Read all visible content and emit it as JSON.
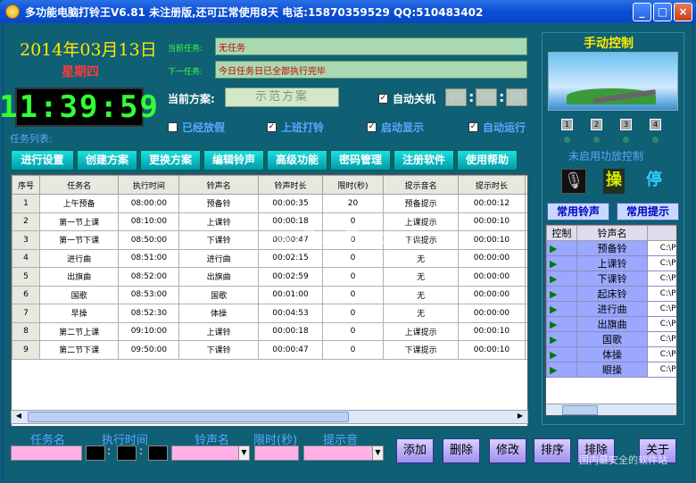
{
  "window": {
    "title": "多功能电脑打铃王V6.81 未注册版,还可正常使用8天 电话:15870359529 QQ:510483402"
  },
  "datetime": {
    "date": "2014年03月13日",
    "weekday": "星期四",
    "time": "11:39:59"
  },
  "tasks": {
    "current_label": "当前任务:",
    "current_value": "无任务",
    "next_label": "下一任务:",
    "next_value": "今日任务日已全部执行完毕"
  },
  "scheme": {
    "label": "当前方案:",
    "value": "示范方案"
  },
  "autoshutdown": {
    "label": "自动关机",
    "h": "20",
    "m": "00",
    "s": "00"
  },
  "checks": {
    "holiday": "已经放假",
    "work_bell": "上班打铃",
    "show_on_start": "启动显示",
    "auto_run": "自动运行"
  },
  "list_label": "任务列表:",
  "toolbar": [
    "进行设置",
    "创建方案",
    "更换方案",
    "编辑铃声",
    "高级功能",
    "密码管理",
    "注册软件",
    "使用帮助"
  ],
  "table": {
    "headers": [
      "序号",
      "任务名",
      "执行时间",
      "铃声名",
      "铃声时长",
      "限时(秒)",
      "提示音名",
      "提示时长",
      "星"
    ],
    "rows": [
      [
        "1",
        "上午预备",
        "08:00:00",
        "预备铃",
        "00:00:35",
        "20",
        "预备提示",
        "00:00:12",
        "执"
      ],
      [
        "2",
        "第一节上课",
        "08:10:00",
        "上课铃",
        "00:00:18",
        "0",
        "上课提示",
        "00:00:10",
        "执"
      ],
      [
        "3",
        "第一节下课",
        "08:50:00",
        "下课铃",
        "00:00:47",
        "0",
        "下课提示",
        "00:00:10",
        "执"
      ],
      [
        "4",
        "进行曲",
        "08:51:00",
        "进行曲",
        "00:02:15",
        "0",
        "无",
        "00:00:00",
        "执"
      ],
      [
        "5",
        "出旗曲",
        "08:52:00",
        "出旗曲",
        "00:02:59",
        "0",
        "无",
        "00:00:00",
        "执"
      ],
      [
        "6",
        "国歌",
        "08:53:00",
        "国歌",
        "00:01:00",
        "0",
        "无",
        "00:00:00",
        "执"
      ],
      [
        "7",
        "早操",
        "08:52:30",
        "体操",
        "00:04:53",
        "0",
        "无",
        "00:00:00",
        "不"
      ],
      [
        "8",
        "第二节上课",
        "09:10:00",
        "上课铃",
        "00:00:18",
        "0",
        "上课提示",
        "00:00:10",
        "执"
      ],
      [
        "9",
        "第二节下课",
        "09:50:00",
        "下课铃",
        "00:00:47",
        "0",
        "下课提示",
        "00:00:10",
        "执"
      ]
    ]
  },
  "manual": {
    "title": "手动控制",
    "channels": [
      "1",
      "2",
      "3",
      "4"
    ],
    "amp_status": "未启用功放控制",
    "op_btn": "操",
    "stop_btn": "停",
    "common_bell": "常用铃声",
    "common_tip": "常用提示",
    "list_headers": [
      "控制",
      "铃声名"
    ],
    "list": [
      {
        "name": "预备铃",
        "path": "C:\\P"
      },
      {
        "name": "上课铃",
        "path": "C:\\P"
      },
      {
        "name": "下课铃",
        "path": "C:\\P"
      },
      {
        "name": "起床铃",
        "path": "C:\\P"
      },
      {
        "name": "进行曲",
        "path": "C:\\P"
      },
      {
        "name": "出旗曲",
        "path": "C:\\P"
      },
      {
        "name": "国歌",
        "path": "C:\\P"
      },
      {
        "name": "体操",
        "path": "C:\\P"
      },
      {
        "name": "眼操",
        "path": "C:\\P"
      }
    ]
  },
  "form": {
    "task_name": "任务名",
    "exec_time": "执行时间",
    "bell_name": "铃声名",
    "limit": "限时(秒)",
    "tip_sound": "提示音",
    "buttons": [
      "添加",
      "删除",
      "修改",
      "排序",
      "排除",
      "关于"
    ]
  },
  "watermarks": {
    "center": "www.DuoTe.com",
    "corner": "国内最安全的软件站"
  }
}
